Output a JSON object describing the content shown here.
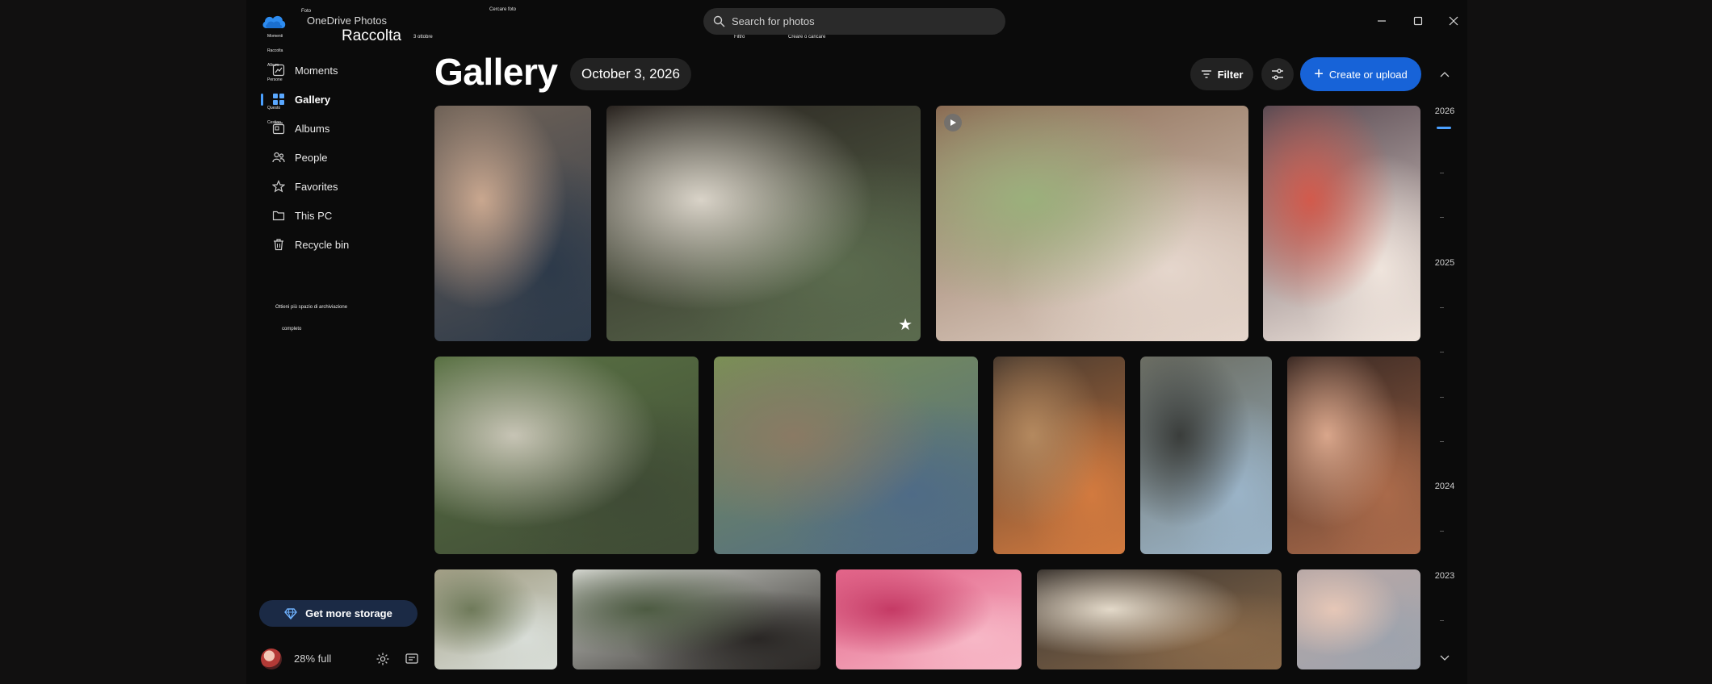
{
  "app": {
    "title": "OneDrive Photos",
    "section": "Raccolta",
    "overlay": {
      "foto": "Foto",
      "cercare": "Cercare foto",
      "date": "3 ottobre",
      "momenti": "Momenti",
      "raccolta": "Raccolta",
      "album": "Album",
      "persone": "Persone",
      "questo": "Questo",
      "cestino": "Cestino",
      "filtro": "Filtro",
      "crea": "Creare o caricare",
      "spazio": "Ottieni più spazio di archiviazione",
      "completo": "completo"
    }
  },
  "sidebar": {
    "items": [
      {
        "label": "Moments",
        "icon": "moments-icon",
        "active": false
      },
      {
        "label": "Gallery",
        "icon": "gallery-icon",
        "active": true
      },
      {
        "label": "Albums",
        "icon": "albums-icon",
        "active": false
      },
      {
        "label": "People",
        "icon": "people-icon",
        "active": false
      },
      {
        "label": "Favorites",
        "icon": "star-icon",
        "active": false
      },
      {
        "label": "This PC",
        "icon": "folder-icon",
        "active": false
      },
      {
        "label": "Recycle bin",
        "icon": "trash-icon",
        "active": false
      }
    ],
    "storage_button": "Get more storage",
    "storage_usage": "28% full"
  },
  "search": {
    "placeholder": "Search for photos"
  },
  "header": {
    "title": "Gallery",
    "date": "October 3, 2026",
    "filter_label": "Filter",
    "create_label": "Create or upload"
  },
  "timeline": {
    "years": [
      "2026",
      "2025",
      "2024",
      "2023"
    ]
  },
  "photos": [
    {
      "desc": "girl-laughing",
      "colors": [
        "#6f6257",
        "#c9a78f",
        "#2d3a4a"
      ]
    },
    {
      "desc": "child-cardboard-tv",
      "colors": [
        "#2b2521",
        "#d9d3c8",
        "#5b6b4e"
      ]
    },
    {
      "desc": "family-garden-tea-party",
      "colors": [
        "#8a6b53",
        "#9bb07c",
        "#e5d6cc"
      ],
      "video": true
    },
    {
      "desc": "pouring-red-juice",
      "colors": [
        "#5a4a52",
        "#d25a4c",
        "#efe4dc"
      ]
    },
    {
      "desc": "girls-in-meadow",
      "colors": [
        "#5a7244",
        "#c7c4b5",
        "#3f4b35"
      ]
    },
    {
      "desc": "kids-dinosaur-masks",
      "colors": [
        "#7b8f55",
        "#8a7a64",
        "#4f6b86"
      ]
    },
    {
      "desc": "rain-boots-mud",
      "colors": [
        "#4a3b2f",
        "#b4895f",
        "#d27a3f"
      ]
    },
    {
      "desc": "kids-with-umbrella",
      "colors": [
        "#6c6e63",
        "#3a3d3b",
        "#9ab3c7"
      ]
    },
    {
      "desc": "laughing-embrace",
      "colors": [
        "#3b2a24",
        "#d9a68b",
        "#aa6a4a"
      ]
    },
    {
      "desc": "dog-in-field",
      "colors": [
        "#a39f86",
        "#6f7a5a",
        "#d8ddd7"
      ]
    },
    {
      "desc": "dog-at-window",
      "colors": [
        "#d4d6cf",
        "#4d5b42",
        "#2a2725"
      ]
    },
    {
      "desc": "pink-blossoms",
      "colors": [
        "#e36489",
        "#c53a65",
        "#f7b7c6"
      ]
    },
    {
      "desc": "woman-cooking",
      "colors": [
        "#3c3631",
        "#e3d9c9",
        "#8a6a4a"
      ]
    },
    {
      "desc": "pastel-sky",
      "colors": [
        "#b8a8a6",
        "#e6c7b7",
        "#9ea3ad"
      ]
    }
  ]
}
